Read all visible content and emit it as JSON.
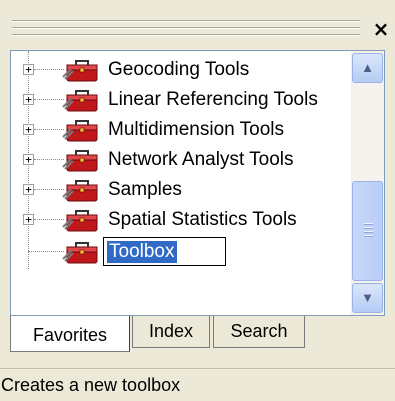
{
  "window": {
    "close_glyph": "×"
  },
  "tree": {
    "items": [
      {
        "label": "Geocoding Tools",
        "expander": "+",
        "icon": "toolbox-icon"
      },
      {
        "label": "Linear Referencing Tools",
        "expander": "+",
        "icon": "toolbox-icon"
      },
      {
        "label": "Multidimension Tools",
        "expander": "+",
        "icon": "toolbox-icon"
      },
      {
        "label": "Network Analyst Tools",
        "expander": "+",
        "icon": "toolbox-icon"
      },
      {
        "label": "Samples",
        "expander": "+",
        "icon": "toolbox-icon"
      },
      {
        "label": "Spatial Statistics Tools",
        "expander": "+",
        "icon": "toolbox-icon"
      }
    ],
    "editing_item": {
      "value": "Toolbox",
      "icon": "toolbox-icon"
    }
  },
  "scrollbar": {
    "up_glyph": "▲",
    "down_glyph": "▼"
  },
  "tabs": [
    {
      "label": "Favorites",
      "active": true
    },
    {
      "label": "Index",
      "active": false
    },
    {
      "label": "Search",
      "active": false
    }
  ],
  "status": {
    "text": "Creates a new toolbox"
  },
  "colors": {
    "selection": "#316ac5",
    "toolbox_red": "#c0171b",
    "panel_bg": "#ece9d8"
  }
}
